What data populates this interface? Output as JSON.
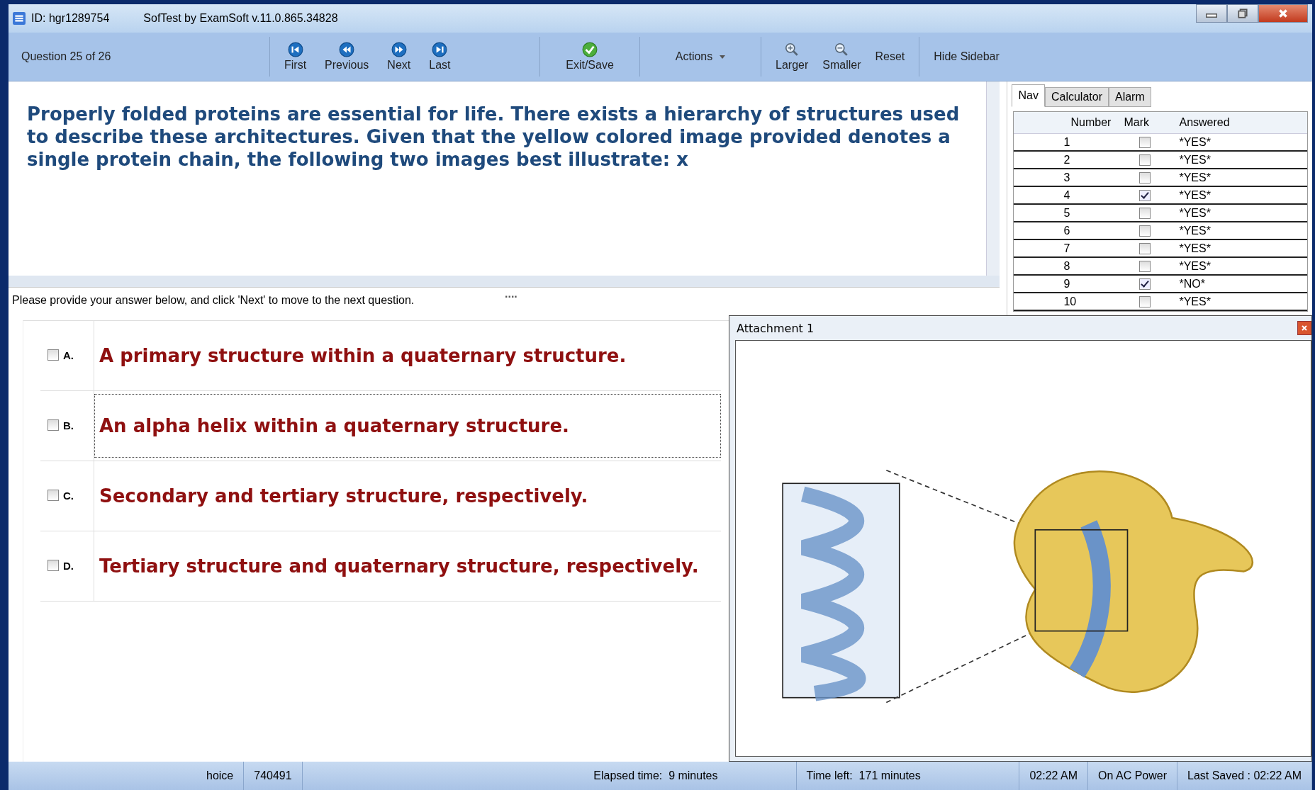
{
  "window": {
    "id": "ID: hgr1289754",
    "title": "SofTest by ExamSoft v.11.0.865.34828"
  },
  "toolbar": {
    "counter": "Question 25 of 26",
    "nav": [
      {
        "kind": "first",
        "label": "First"
      },
      {
        "kind": "previous",
        "label": "Previous"
      },
      {
        "kind": "next",
        "label": "Next"
      },
      {
        "kind": "last",
        "label": "Last"
      }
    ],
    "exit": "Exit/Save",
    "actions": "Actions",
    "zoom": [
      {
        "kind": "in",
        "label": "Larger"
      },
      {
        "kind": "out",
        "label": "Smaller"
      }
    ],
    "reset": "Reset",
    "hide_sidebar": "Hide Sidebar"
  },
  "question": {
    "text": "Properly folded proteins are essential for life. There exists a hierarchy of structures used to describe these architectures. Given that the yellow colored image provided denotes a single protein chain, the following two images best illustrate: x",
    "instruction": "Please provide your answer below, and click 'Next' to move to the next question.",
    "splitter": "...."
  },
  "answers": [
    {
      "letter": "A.",
      "text": "A primary structure within a quaternary structure.",
      "checked": false,
      "focused": false
    },
    {
      "letter": "B.",
      "text": "An alpha helix within a quaternary structure.",
      "checked": false,
      "focused": true
    },
    {
      "letter": "C.",
      "text": "Secondary and tertiary structure, respectively.",
      "checked": false,
      "focused": false
    },
    {
      "letter": "D.",
      "text": "Tertiary structure and quaternary structure, respectively.",
      "checked": false,
      "focused": false
    }
  ],
  "sidebar": {
    "tabs": [
      {
        "label": "Nav",
        "selected": true
      },
      {
        "label": "Calculator",
        "selected": false
      },
      {
        "label": "Alarm",
        "selected": false
      }
    ],
    "columns": [
      "Number",
      "Mark",
      "Answered"
    ],
    "rows": [
      {
        "number": "1",
        "marked": false,
        "answered": "*YES*"
      },
      {
        "number": "2",
        "marked": false,
        "answered": "*YES*"
      },
      {
        "number": "3",
        "marked": false,
        "answered": "*YES*"
      },
      {
        "number": "4",
        "marked": true,
        "answered": "*YES*"
      },
      {
        "number": "5",
        "marked": false,
        "answered": "*YES*"
      },
      {
        "number": "6",
        "marked": false,
        "answered": "*YES*"
      },
      {
        "number": "7",
        "marked": false,
        "answered": "*YES*"
      },
      {
        "number": "8",
        "marked": false,
        "answered": "*YES*"
      },
      {
        "number": "9",
        "marked": true,
        "answered": "*NO*"
      },
      {
        "number": "10",
        "marked": false,
        "answered": "*YES*"
      }
    ]
  },
  "attachment": {
    "title": "Attachment 1"
  },
  "status_bar": [
    "hoice",
    "740491",
    "Elapsed time:  9 minutes",
    "Time left:  171 minutes",
    "02:22 AM",
    "On AC Power",
    "Last Saved : 02:22 AM"
  ]
}
